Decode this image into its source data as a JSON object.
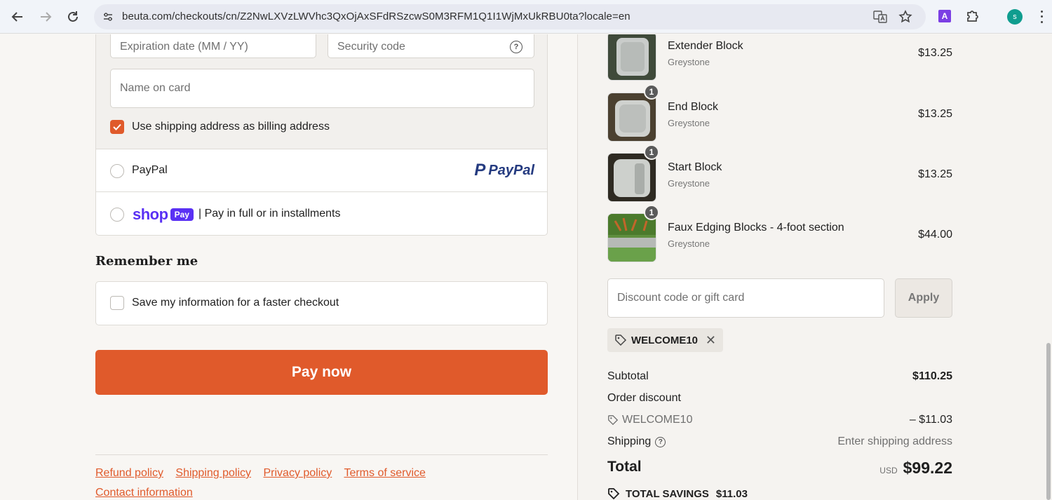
{
  "browser": {
    "url": "beuta.com/checkouts/cn/Z2NwLXVzLWVhc3QxOjAxSFdRSzcwS0M3RFM1Q1I1WjMxUkRBU0ta?locale=en",
    "ext_letter": "A",
    "profile_initial": "s"
  },
  "payment": {
    "expiration_placeholder": "Expiration date (MM / YY)",
    "security_placeholder": "Security code",
    "name_placeholder": "Name on card",
    "billing_label": "Use shipping address as billing address",
    "paypal_label": "PayPal",
    "paypal_logo_p": "P",
    "paypal_logo_text": "PayPal",
    "shop_word": "shop",
    "shop_pay_badge": "Pay",
    "shop_label": "| Pay in full or in installments"
  },
  "remember": {
    "title": "Remember me",
    "save_label": "Save my information for a faster checkout"
  },
  "pay_now": "Pay now",
  "footer": {
    "links": [
      "Refund policy",
      "Shipping policy",
      "Privacy policy",
      "Terms of service"
    ],
    "contact": "Contact information"
  },
  "order": {
    "items": [
      {
        "name": "Extender Block",
        "variant": "Greystone",
        "price": "$13.25",
        "qty": ""
      },
      {
        "name": "End Block",
        "variant": "Greystone",
        "price": "$13.25",
        "qty": "1"
      },
      {
        "name": "Start Block",
        "variant": "Greystone",
        "price": "$13.25",
        "qty": "1"
      },
      {
        "name": "Faux Edging Blocks - 4-foot section",
        "variant": "Greystone",
        "price": "$44.00",
        "qty": "1"
      }
    ],
    "discount_placeholder": "Discount code or gift card",
    "apply_label": "Apply",
    "applied_code": "WELCOME10",
    "subtotal_label": "Subtotal",
    "subtotal_value": "$110.25",
    "order_discount_label": "Order discount",
    "discount_code": "WELCOME10",
    "discount_value": "– $11.03",
    "shipping_label": "Shipping",
    "shipping_value": "Enter shipping address",
    "total_label": "Total",
    "currency": "USD",
    "total_value": "$99.22",
    "savings_label": "TOTAL SAVINGS",
    "savings_value": "$11.03"
  },
  "colors": {
    "accent": "#e05a2b",
    "shop_purple": "#5a31f4",
    "paypal_dark": "#253b80",
    "paypal_light": "#179bd7"
  }
}
